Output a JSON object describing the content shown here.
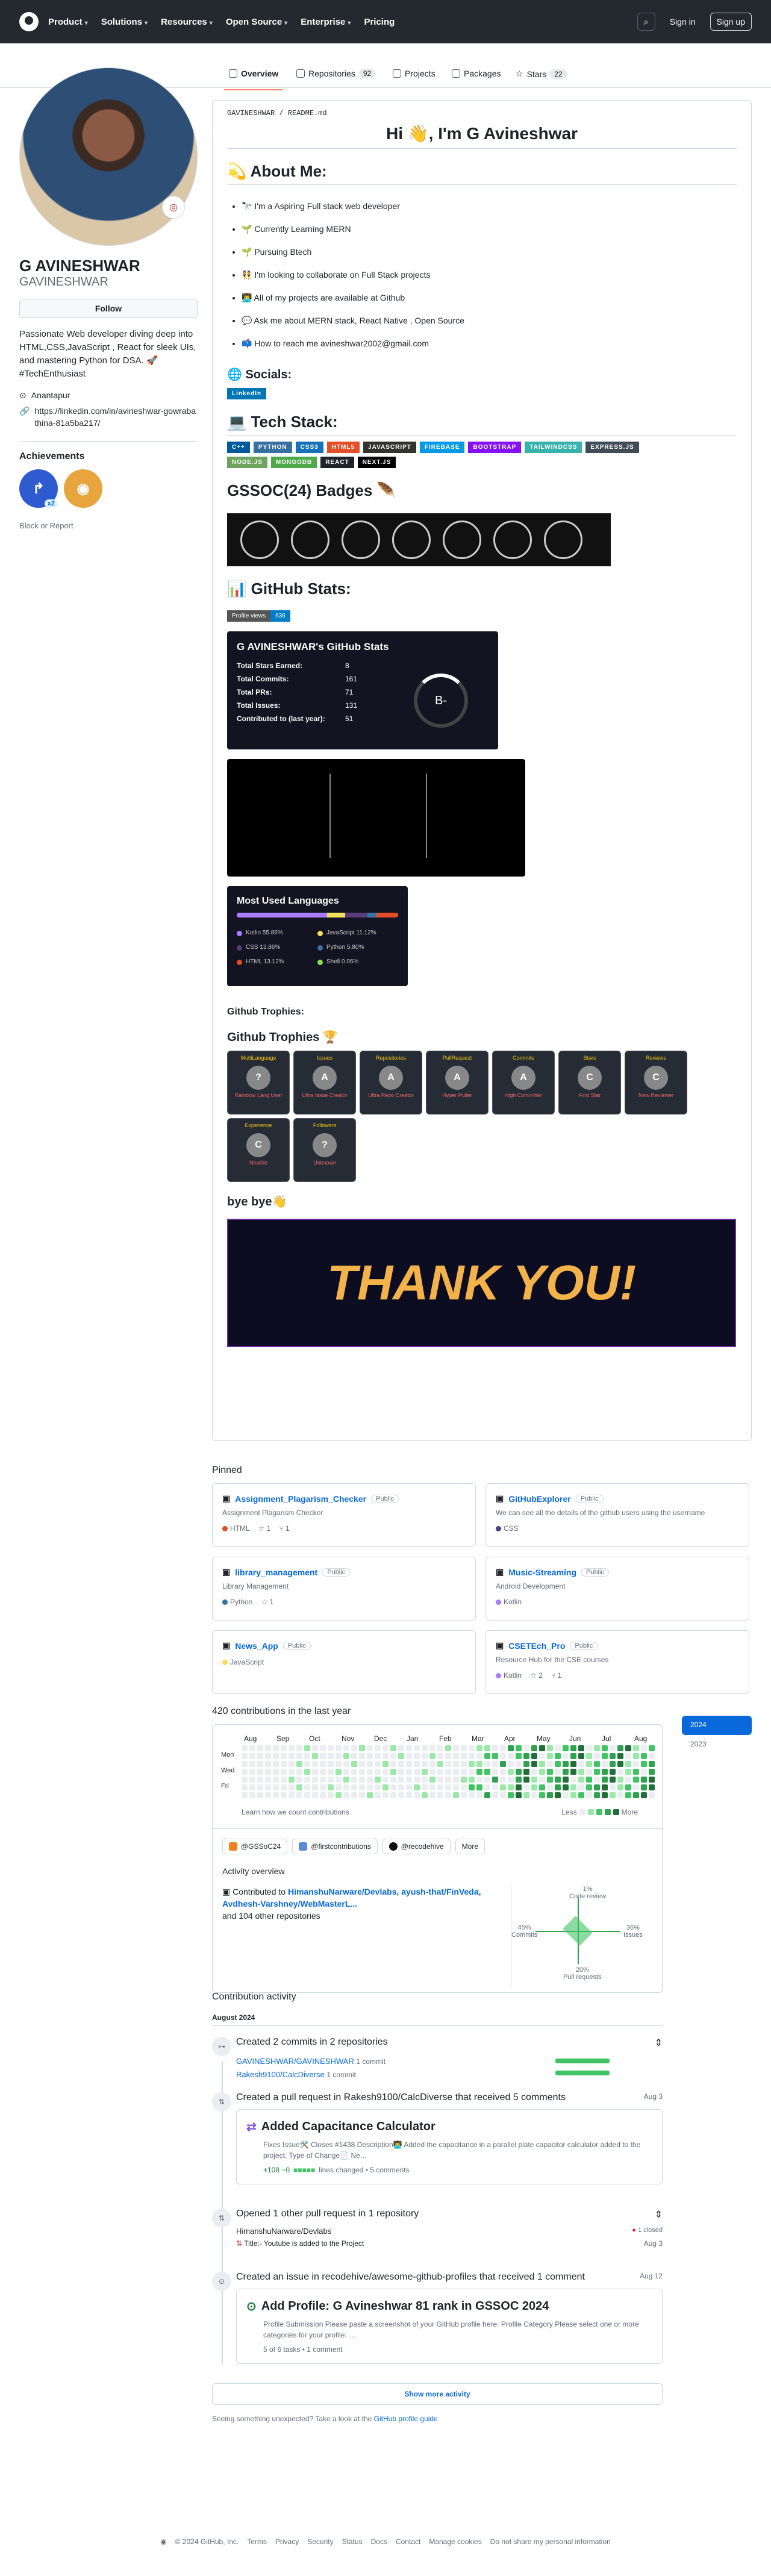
{
  "header": {
    "nav": [
      "Product",
      "Solutions",
      "Resources",
      "Open Source",
      "Enterprise",
      "Pricing"
    ],
    "sign_in": "Sign in",
    "sign_up": "Sign up"
  },
  "tabs": [
    {
      "label": "Overview"
    },
    {
      "label": "Repositories",
      "count": "92"
    },
    {
      "label": "Projects"
    },
    {
      "label": "Packages"
    },
    {
      "label": "Stars",
      "count": "22"
    }
  ],
  "profile": {
    "name": "G AVINESHWAR",
    "login": "GAVINESHWAR",
    "follow": "Follow",
    "bio": "Passionate Web developer diving deep into HTML,CSS,JavaScript , React for sleek UIs, and mastering Python for DSA. 🚀 #TechEnthusiast",
    "location": "Anantapur",
    "link": "https://linkedin.com/in/avineshwar-gowrabathina-81a5ba217/",
    "achievements": "Achievements",
    "ach_count": "x2",
    "block": "Block or Report"
  },
  "readme": {
    "path": "GAVINESHWAR / README.md",
    "hi": "Hi 👋, I'm G Avineshwar",
    "about": "💫 About Me:",
    "items": [
      "🔭 I'm a Aspiring Full stack web developer",
      "🌱 Currently Learning MERN",
      "🌱 Pursuing Btech",
      "👯 I'm looking to collaborate on Full Stack projects",
      "👨‍💻 All of my projects are available at Github",
      "💬 Ask me about MERN stack, React Native , Open Source",
      "📫 How to reach me avineshwar2002@gmail.com"
    ],
    "socials": "🌐 Socials:",
    "linkedin": "LinkedIn",
    "tech": "💻 Tech Stack:",
    "tech_items": [
      {
        "t": "C++",
        "c": "#00599C"
      },
      {
        "t": "PYTHON",
        "c": "#3670A0"
      },
      {
        "t": "CSS3",
        "c": "#1572B6"
      },
      {
        "t": "HTML5",
        "c": "#E34F26"
      },
      {
        "t": "JAVASCRIPT",
        "c": "#323330"
      },
      {
        "t": "FIREBASE",
        "c": "#039BE5"
      },
      {
        "t": "BOOTSTRAP",
        "c": "#8511FA"
      },
      {
        "t": "TAILWINDCSS",
        "c": "#38B2AC"
      },
      {
        "t": "EXPRESS.JS",
        "c": "#404d59"
      },
      {
        "t": "NODE.JS",
        "c": "#6DA55F"
      },
      {
        "t": "MONGODB",
        "c": "#4ea94b"
      },
      {
        "t": "REACT",
        "c": "#20232a"
      },
      {
        "t": "NEXT.JS",
        "c": "#000000"
      }
    ],
    "gssoc": "GSSOC(24) Badges 🪶",
    "stats_title": "📊 GitHub Stats:",
    "views": "Profile views",
    "views_n": "636",
    "stats": {
      "title": "G AVINESHWAR's GitHub Stats",
      "rows": [
        [
          "Total Stars Earned:",
          "8"
        ],
        [
          "Total Commits:",
          "161"
        ],
        [
          "Total PRs:",
          "71"
        ],
        [
          "Total Issues:",
          "131"
        ],
        [
          "Contributed to (last year):",
          "51"
        ]
      ],
      "grade": "B-"
    },
    "langs": {
      "title": "Most Used Languages",
      "items": [
        {
          "n": "Kotlin 55.86%",
          "c": "#A97BFF",
          "v": 55.86
        },
        {
          "n": "JavaScript 11.12%",
          "c": "#f1e05a",
          "v": 11.12
        },
        {
          "n": "CSS 13.86%",
          "c": "#563d7c",
          "v": 13.86
        },
        {
          "n": "Python 5.80%",
          "c": "#3572A5",
          "v": 5.8
        },
        {
          "n": "HTML 13.12%",
          "c": "#e34c26",
          "v": 13.12
        },
        {
          "n": "Shell 0.06%",
          "c": "#89e051",
          "v": 0.06
        }
      ]
    },
    "gh_trophies": "Github Trophies:",
    "gh_trophies2": "Github Trophies 🏆",
    "trophies": [
      {
        "t": "MultiLanguage",
        "r": "?",
        "s": "Rainbow Lang User"
      },
      {
        "t": "Issues",
        "r": "A",
        "s": "Ultra Issue Creator"
      },
      {
        "t": "Repositories",
        "r": "A",
        "s": "Ultra Repo Creator"
      },
      {
        "t": "PullRequest",
        "r": "A",
        "s": "Hyper Puller"
      },
      {
        "t": "Commits",
        "r": "A",
        "s": "High Committer"
      },
      {
        "t": "Stars",
        "r": "C",
        "s": "First Star"
      },
      {
        "t": "Reviews",
        "r": "C",
        "s": "New Reviewer"
      },
      {
        "t": "Experience",
        "r": "C",
        "s": "Newbie"
      },
      {
        "t": "Followers",
        "r": "?",
        "s": "Unknown"
      }
    ],
    "bye": "bye bye👋",
    "thanks": "THANK YOU!"
  },
  "pinned": {
    "title": "Pinned",
    "public": "Public",
    "repos": [
      {
        "name": "Assignment_Plagarism_Checker",
        "desc": "Assignment Plagarism Checker",
        "lang": "HTML",
        "lc": "#e34c26",
        "stars": "1",
        "forks": "1"
      },
      {
        "name": "GitHubExplorer",
        "desc": "We can see all the details of the github users using the username",
        "lang": "CSS",
        "lc": "#563d7c"
      },
      {
        "name": "library_management",
        "desc": "Library Management",
        "lang": "Python",
        "lc": "#3572A5",
        "stars": "1"
      },
      {
        "name": "Music-Streaming",
        "desc": "Android Development",
        "lang": "Kotlin",
        "lc": "#A97BFF"
      },
      {
        "name": "News_App",
        "desc": "",
        "lang": "JavaScript",
        "lc": "#f1e05a"
      },
      {
        "name": "CSETEch_Pro",
        "desc": "Resource Hub for the CSE courses",
        "lang": "Kotlin",
        "lc": "#A97BFF",
        "stars": "2",
        "forks": "1"
      }
    ]
  },
  "contrib": {
    "title": "420 contributions in the last year",
    "months": [
      "Aug",
      "Sep",
      "Oct",
      "Nov",
      "Dec",
      "Jan",
      "Feb",
      "Mar",
      "Apr",
      "May",
      "Jun",
      "Jul",
      "Aug"
    ],
    "days": [
      "Mon",
      "Wed",
      "Fri"
    ],
    "learn": "Learn how we count contributions",
    "less": "Less",
    "more": "More",
    "years": [
      "2024",
      "2023"
    ],
    "orgs": [
      "@GSSoC24",
      "@firstcontributions",
      "@recodehive",
      "More"
    ],
    "overview": "Activity overview",
    "contributed": "Contributed to",
    "contributed_repos": "HimanshuNarware/Devlabs, ayush-that/FinVeda, Avdhesh-Varshney/WebMasterL...",
    "other": "and 104 other repositories",
    "axes": {
      "code_review": "1%",
      "code_review_l": "Code review",
      "commits": "45%",
      "commits_l": "Commits",
      "issues": "36%",
      "issues_l": "Issues",
      "prs": "20%",
      "prs_l": "Pull requests"
    }
  },
  "activity": {
    "title": "Contribution activity",
    "month": "August 2024",
    "e1": {
      "t": "Created 2 commits in 2 repositories",
      "r1": "GAVINESHWAR/GAVINESHWAR",
      "c1": "1 commit",
      "r2": "Rakesh9100/CalcDiverse",
      "c2": "1 commit"
    },
    "e2": {
      "t": "Created a pull request in Rakesh9100/CalcDiverse that received 5 comments",
      "d": "Aug 3",
      "title": "Added Capacitance Calculator",
      "body": "Fixes Issue🛠️ Closes #1438 Description👨‍💻 Added the capacitance in a parallel plate capacitor calculator added to the project. Type of Change📄 Ne…",
      "stat": "+108 −0",
      "lines": "lines changed • 5 comments"
    },
    "e3": {
      "t": "Opened 1 other pull request in 1 repository",
      "repo": "HimanshuNarware/Devlabs",
      "closed": "1 closed",
      "pr": "Title:- Youtube is added to the Project",
      "d": "Aug 3"
    },
    "e4": {
      "t": "Created an issue in recodehive/awesome-github-profiles that received 1 comment",
      "d": "Aug 12",
      "title": "Add Profile: G Avineshwar 81 rank in GSSOC 2024",
      "body": "Profile Submission Please paste a screenshot of your GitHub profile here: Profile Category Please select one or more categories for your profile: …",
      "tasks": "5 of 6 tasks • 1 comment"
    },
    "more": "Show more activity",
    "unexpected": "Seeing something unexpected? Take a look at the",
    "guide": "GitHub profile guide"
  },
  "footer": [
    "© 2024 GitHub, Inc.",
    "Terms",
    "Privacy",
    "Security",
    "Status",
    "Docs",
    "Contact",
    "Manage cookies",
    "Do not share my personal information"
  ]
}
